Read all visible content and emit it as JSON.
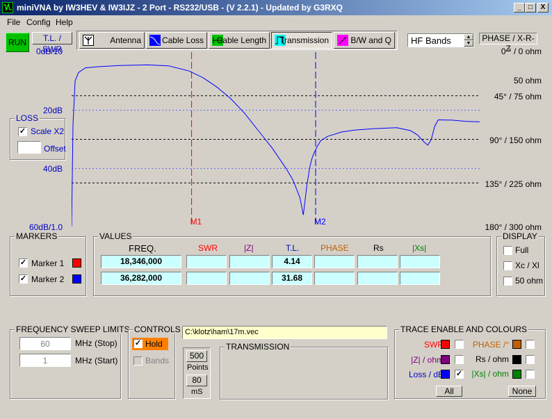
{
  "window": {
    "title": "miniVNA by IW3HEV & IW3IJZ - 2 Port - RS232/USB -  (V 2.2.1) - Updated by G3RXQ",
    "controls": [
      "_",
      "□",
      "X"
    ]
  },
  "menu": [
    "File",
    "Config",
    "Help"
  ],
  "toolbar": {
    "run_label": "RUN",
    "tl_swr_label": "T.L. / SWR",
    "tabs": [
      {
        "label": "Antenna",
        "icon": "antenna-icon"
      },
      {
        "label": "Cable Loss",
        "icon": "cable-loss-icon"
      },
      {
        "label": "Cable Length",
        "icon": "cable-length-icon"
      },
      {
        "label": "Transmission",
        "icon": "transmission-icon"
      },
      {
        "label": "B/W and Q",
        "icon": "bandwidth-q-icon"
      }
    ],
    "band_select": "HF Bands",
    "phase_label": "PHASE / X-R-Z"
  },
  "chart_data": {
    "type": "line",
    "left_axis_labels": [
      "0dB/10",
      "20dB",
      "40dB",
      "60dB/1.0"
    ],
    "right_axis_labels": [
      "0 ° / 0 ohm",
      "50 ohm",
      "45° / 75 ohm",
      "90° / 150 ohm",
      "135° / 225 ohm",
      "180° / 300 ohm"
    ],
    "ylim": [
      0,
      60
    ],
    "xlim_mhz": [
      1,
      60
    ],
    "markers": [
      {
        "label": "M1",
        "freq_mhz": 18.346,
        "color": "#ff0000"
      },
      {
        "label": "M2",
        "freq_mhz": 36.282,
        "color": "#0000ff"
      }
    ],
    "series": [
      {
        "color": "#0000ff",
        "x": [
          1,
          1.2,
          1.5,
          2,
          3,
          5,
          8,
          12,
          15,
          18,
          20,
          22,
          24,
          26,
          28,
          30,
          32,
          33,
          34,
          34.5,
          35,
          35.4,
          35.7,
          36,
          36.5,
          37,
          38,
          40,
          42,
          45,
          48,
          50,
          51,
          52,
          52.5,
          53,
          53.5,
          54,
          56,
          58,
          60
        ],
        "y": [
          60,
          25,
          10,
          7,
          5.4,
          5,
          4.6,
          4.4,
          4.7,
          6.5,
          8.8,
          12,
          16,
          21,
          27,
          33,
          40,
          44,
          50,
          56,
          46,
          40,
          37,
          35,
          32.5,
          30.5,
          29,
          27.5,
          26.8,
          26.3,
          26,
          27,
          28.5,
          31,
          32,
          30,
          25.5,
          23.3,
          23.4,
          23.8,
          24
        ]
      }
    ]
  },
  "loss_panel": {
    "title": "LOSS",
    "scale_label": "Scale X2",
    "scale_checked": true,
    "offset_label": "Offset",
    "offset_value": ""
  },
  "markers_panel": {
    "title": "MARKERS",
    "items": [
      {
        "label": "Marker 1",
        "checked": true,
        "color": "#ff0000"
      },
      {
        "label": "Marker 2",
        "checked": true,
        "color": "#0000ff"
      }
    ]
  },
  "values_panel": {
    "title": "VALUES",
    "headers": [
      "FREQ.",
      "SWR",
      "|Z|",
      "T.L.",
      "PHASE",
      "Rs",
      "|Xs|"
    ],
    "header_colors": [
      "#000000",
      "#ff0000",
      "#800080",
      "#0000c0",
      "#c06000",
      "#000000",
      "#008000"
    ],
    "rows": [
      [
        "18,346,000",
        "",
        "",
        "4.14",
        "",
        "",
        ""
      ],
      [
        "36,282,000",
        "",
        "",
        "31.68",
        "",
        "",
        ""
      ]
    ]
  },
  "display_panel": {
    "title": "DISPLAY",
    "items": [
      {
        "label": "Full",
        "checked": false
      },
      {
        "label": "Xc / Xl",
        "checked": false
      },
      {
        "label": "50 ohm",
        "checked": false
      }
    ]
  },
  "sweep_panel": {
    "title": "FREQUENCY SWEEP LIMITS",
    "stop_value": "60",
    "stop_label": "MHz (Stop)",
    "start_value": "1",
    "start_label": "MHz (Start)"
  },
  "controls_panel": {
    "title": "CONTROLS",
    "hold_label": "Hold",
    "hold_checked": true,
    "bands_label": "Bands",
    "bands_checked": false
  },
  "points": {
    "value": "500",
    "label": "Points",
    "ms_value": "80",
    "ms_label": "mS"
  },
  "file_path": "C:\\klotz\\ham\\17m.vec",
  "transmission_panel": {
    "title": "TRANSMISSION"
  },
  "trace_panel": {
    "title": "TRACE ENABLE AND COLOURS",
    "items": [
      {
        "label": "SWR",
        "color": "#ff0000",
        "swatch": "#ff0000",
        "checked": false
      },
      {
        "label": "PHASE /°",
        "color": "#c06000",
        "swatch": "#c06000",
        "checked": false
      },
      {
        "label": "|Z| / ohm",
        "color": "#800080",
        "swatch": "#800080",
        "checked": false
      },
      {
        "label": "Rs / ohm",
        "color": "#000000",
        "swatch": "#000000",
        "checked": false
      },
      {
        "label": "Loss / dB",
        "color": "#0000c0",
        "swatch": "#0000ff",
        "checked": true
      },
      {
        "label": "|Xs| / ohm",
        "color": "#008000",
        "swatch": "#008000",
        "checked": false
      }
    ],
    "all_label": "All",
    "none_label": "None"
  }
}
